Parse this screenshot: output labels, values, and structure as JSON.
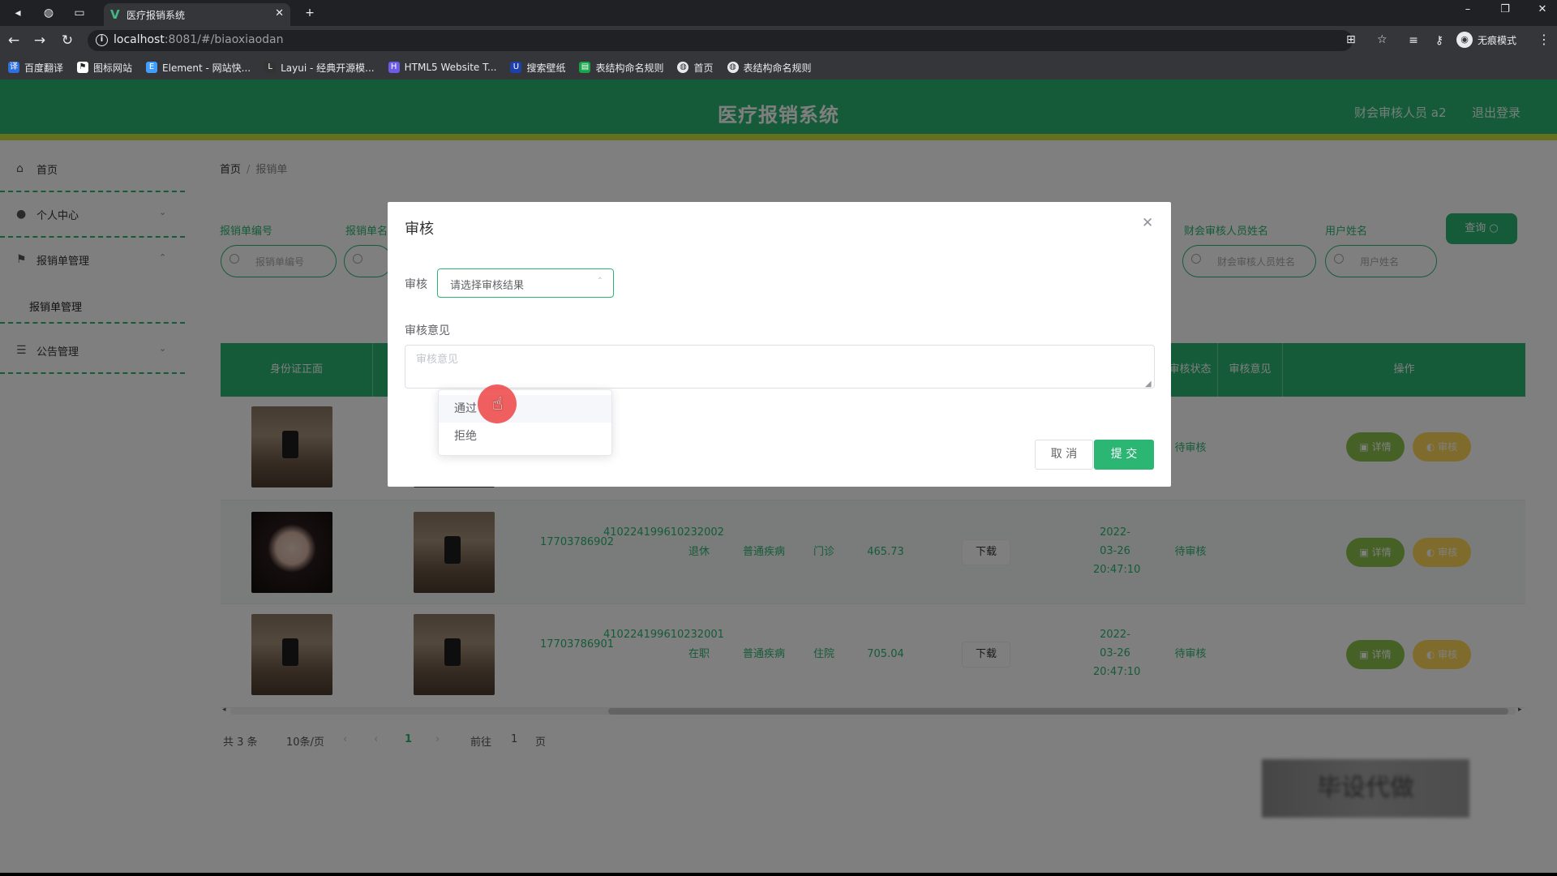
{
  "browser": {
    "tab_title": "医疗报销系统",
    "tab_logo": "V",
    "url_host": "localhost",
    "url_path": ":8081/#/biaoxiaodan",
    "incognito_label": "无痕模式",
    "bookmarks": [
      "百度翻译",
      "图标网站",
      "Element - 网站快...",
      "Layui - 经典开源模...",
      "HTML5 Website T...",
      "搜索壁纸",
      "表结构命名规则",
      "首页",
      "表结构命名规则"
    ]
  },
  "app": {
    "title": "医疗报销系统",
    "user_label": "财会审核人员 a2",
    "logout_label": "退出登录",
    "header_color": "#2bb673",
    "header_accent": "#c8e03a"
  },
  "sidebar": {
    "items": [
      "首页",
      "个人中心",
      "报销单管理",
      "公告管理"
    ],
    "sub_item": "报销单管理"
  },
  "breadcrumb": {
    "home": "首页",
    "separator": "/",
    "current": "报销单"
  },
  "filters": {
    "labels": [
      "报销单编号",
      "报销单名",
      "财会审核人员姓名",
      "用户姓名"
    ],
    "placeholders": [
      "报销单编号",
      "",
      "财会审核人员姓名",
      "用户姓名"
    ],
    "query_button": "查询"
  },
  "table": {
    "headers": {
      "id_photo": "身份证正面",
      "audit_status": "审核状态",
      "audit_opinion": "审核意见",
      "actions": "操作"
    },
    "rows": [
      {
        "phone": "",
        "idcard": "",
        "type": "",
        "disease": "",
        "visit": "",
        "amount": "",
        "download": "",
        "time": "",
        "status": "待审核",
        "opinion": "",
        "detail": "详情",
        "audit": "审核"
      },
      {
        "phone": "17703786902",
        "idcard": "410224199610232002",
        "type": "退休",
        "disease": "普通疾病",
        "visit": "门诊",
        "amount": "465.73",
        "download": "下载",
        "time": "2022-03-26 20:47:10",
        "status": "待审核",
        "opinion": "",
        "detail": "详情",
        "audit": "审核"
      },
      {
        "phone": "17703786901",
        "idcard": "410224199610232001",
        "type": "在职",
        "disease": "普通疾病",
        "visit": "住院",
        "amount": "705.04",
        "download": "下载",
        "time": "2022-03-26 20:47:10",
        "status": "待审核",
        "opinion": "",
        "detail": "详情",
        "audit": "审核"
      }
    ]
  },
  "pagination": {
    "total": "共 3 条",
    "page_size": "10条/页",
    "current_page": "1",
    "goto_label": "前往",
    "goto_value": "1",
    "page_suffix": "页"
  },
  "watermark": "毕设代做",
  "modal": {
    "title": "审核",
    "audit_label": "审核",
    "select_placeholder": "请选择审核结果",
    "opinion_label": "审核意见",
    "opinion_placeholder": "审核意见",
    "cancel_label": "取 消",
    "submit_label": "提 交",
    "dropdown_options": [
      "通过",
      "拒绝"
    ],
    "accent_color": "#2bb673"
  }
}
